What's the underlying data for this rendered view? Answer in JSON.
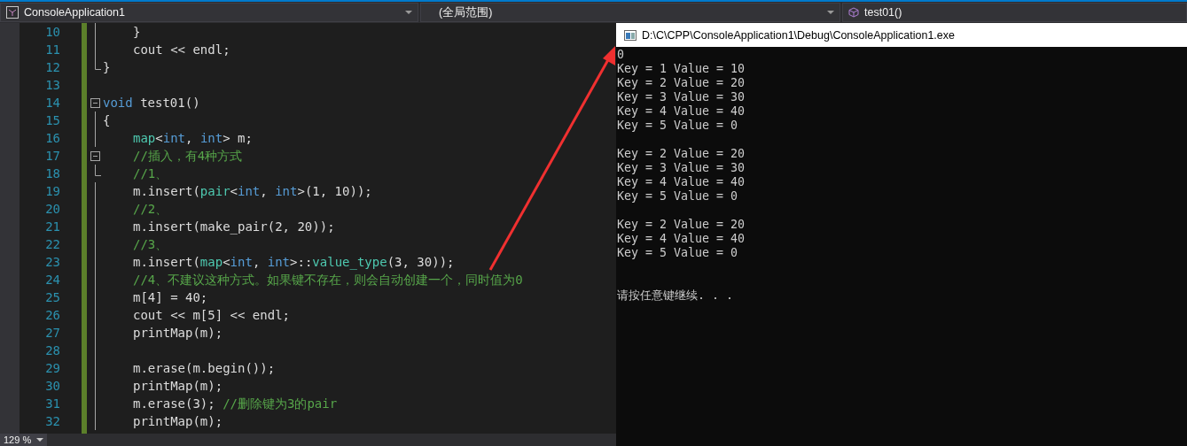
{
  "toolbar": {
    "project": "ConsoleApplication1",
    "scope": "(全局范围)",
    "member": "test01()"
  },
  "editor": {
    "lines": [
      {
        "number": "10",
        "indented": true,
        "kind": "body",
        "tokens": [
          {
            "kind": "plain",
            "text": "}"
          }
        ]
      },
      {
        "number": "11",
        "indented": true,
        "kind": "body",
        "tokens": [
          {
            "kind": "plain",
            "text": "cout << endl;"
          }
        ]
      },
      {
        "number": "12",
        "indented": false,
        "kind": "fold-end",
        "tokens": [
          {
            "kind": "plain",
            "text": "}"
          }
        ]
      },
      {
        "number": "13",
        "kind": "blank"
      },
      {
        "number": "14",
        "indented": false,
        "kind": "fold-start",
        "tokens": [
          {
            "kind": "keyword",
            "text": "void"
          },
          {
            "kind": "plain",
            "text": " test01()"
          }
        ]
      },
      {
        "number": "15",
        "indented": false,
        "kind": "body",
        "tokens": [
          {
            "kind": "plain",
            "text": "{"
          }
        ]
      },
      {
        "number": "16",
        "indented": true,
        "kind": "body",
        "tokens": [
          {
            "kind": "type",
            "text": "map"
          },
          {
            "kind": "plain",
            "text": "<"
          },
          {
            "kind": "keyword",
            "text": "int"
          },
          {
            "kind": "plain",
            "text": ", "
          },
          {
            "kind": "keyword",
            "text": "int"
          },
          {
            "kind": "plain",
            "text": "> m;"
          }
        ]
      },
      {
        "number": "17",
        "indented": true,
        "kind": "fold-start",
        "tokens": [
          {
            "kind": "comment",
            "text": "//插入，有4种方式"
          }
        ]
      },
      {
        "number": "18",
        "indented": true,
        "kind": "fold-end",
        "tokens": [
          {
            "kind": "comment",
            "text": "//1、"
          }
        ]
      },
      {
        "number": "19",
        "indented": true,
        "kind": "body",
        "tokens": [
          {
            "kind": "plain",
            "text": "m.insert("
          },
          {
            "kind": "type",
            "text": "pair"
          },
          {
            "kind": "plain",
            "text": "<"
          },
          {
            "kind": "keyword",
            "text": "int"
          },
          {
            "kind": "plain",
            "text": ", "
          },
          {
            "kind": "keyword",
            "text": "int"
          },
          {
            "kind": "plain",
            "text": ">(1, 10));"
          }
        ]
      },
      {
        "number": "20",
        "indented": true,
        "kind": "body",
        "tokens": [
          {
            "kind": "comment",
            "text": "//2、"
          }
        ]
      },
      {
        "number": "21",
        "indented": true,
        "kind": "body",
        "tokens": [
          {
            "kind": "plain",
            "text": "m.insert(make_pair(2, 20));"
          }
        ]
      },
      {
        "number": "22",
        "indented": true,
        "kind": "body",
        "tokens": [
          {
            "kind": "comment",
            "text": "//3、"
          }
        ]
      },
      {
        "number": "23",
        "indented": true,
        "kind": "body",
        "tokens": [
          {
            "kind": "plain",
            "text": "m.insert("
          },
          {
            "kind": "type",
            "text": "map"
          },
          {
            "kind": "plain",
            "text": "<"
          },
          {
            "kind": "keyword",
            "text": "int"
          },
          {
            "kind": "plain",
            "text": ", "
          },
          {
            "kind": "keyword",
            "text": "int"
          },
          {
            "kind": "plain",
            "text": ">::"
          },
          {
            "kind": "type",
            "text": "value_type"
          },
          {
            "kind": "plain",
            "text": "(3, 30));"
          }
        ]
      },
      {
        "number": "24",
        "indented": true,
        "kind": "body",
        "tokens": [
          {
            "kind": "comment",
            "text": "//4、不建议这种方式。如果键不存在，则会自动创建一个，同时值为0"
          }
        ]
      },
      {
        "number": "25",
        "indented": true,
        "kind": "body",
        "tokens": [
          {
            "kind": "plain",
            "text": "m[4] = 40;"
          }
        ]
      },
      {
        "number": "26",
        "indented": true,
        "kind": "body",
        "tokens": [
          {
            "kind": "plain",
            "text": "cout << m[5] << endl;"
          }
        ]
      },
      {
        "number": "27",
        "indented": true,
        "kind": "body",
        "tokens": [
          {
            "kind": "plain",
            "text": "printMap(m);"
          }
        ]
      },
      {
        "number": "28",
        "kind": "body"
      },
      {
        "number": "29",
        "indented": true,
        "kind": "body",
        "tokens": [
          {
            "kind": "plain",
            "text": "m.erase(m.begin());"
          }
        ]
      },
      {
        "number": "30",
        "indented": true,
        "kind": "body",
        "tokens": [
          {
            "kind": "plain",
            "text": "printMap(m);"
          }
        ]
      },
      {
        "number": "31",
        "indented": true,
        "kind": "body",
        "tokens": [
          {
            "kind": "plain",
            "text": "m.erase(3); "
          },
          {
            "kind": "comment",
            "text": "//删除键为3的pair"
          }
        ]
      },
      {
        "number": "32",
        "indented": true,
        "kind": "body",
        "tokens": [
          {
            "kind": "plain",
            "text": "printMap(m);"
          }
        ]
      }
    ],
    "zoom": "129 %"
  },
  "console": {
    "title": "D:\\C\\CPP\\ConsoleApplication1\\Debug\\ConsoleApplication1.exe",
    "blocks": [
      [
        "0",
        "Key = 1 Value = 10",
        "Key = 2 Value = 20",
        "Key = 3 Value = 30",
        "Key = 4 Value = 40",
        "Key = 5 Value = 0"
      ],
      [
        "Key = 2 Value = 20",
        "Key = 3 Value = 30",
        "Key = 4 Value = 40",
        "Key = 5 Value = 0"
      ],
      [
        "Key = 2 Value = 20",
        "Key = 4 Value = 40",
        "Key = 5 Value = 0"
      ]
    ],
    "prompt": "请按任意键继续. . ."
  }
}
